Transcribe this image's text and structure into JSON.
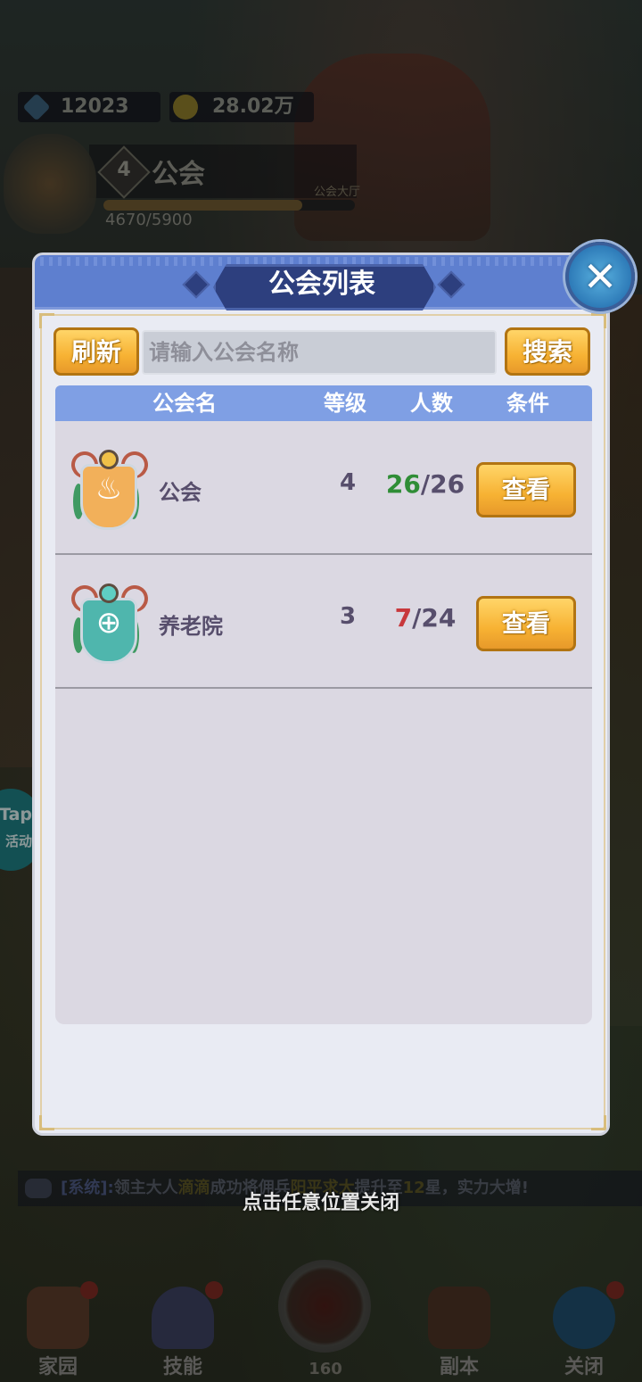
{
  "currency": {
    "gems": "12023",
    "gold": "28.02万"
  },
  "guild_header": {
    "level": "4",
    "name": "公会",
    "hall_label": "公会大厅",
    "exp_text": "4670/5900",
    "exp_fraction": 0.79
  },
  "side_button": {
    "line1": "Tap",
    "line2": "活动"
  },
  "system_message": {
    "tag": "[系统]:",
    "text_a": "领主大人",
    "highlight_a": "滴滴",
    "text_b": "成功将佣兵",
    "highlight_b": "阳平求大",
    "text_c": "提升至",
    "highlight_c": "12",
    "text_d": "星，实力大增!"
  },
  "dialog": {
    "title": "公会列表",
    "refresh_label": "刷新",
    "search_placeholder": "请输入公会名称",
    "search_value": "",
    "search_label": "搜索",
    "columns": {
      "name": "公会名",
      "level": "等级",
      "members": "人数",
      "condition": "条件"
    },
    "rows": [
      {
        "name": "公会",
        "level": "4",
        "members_current": "26",
        "members_max": "/26",
        "view_label": "查看",
        "emblem": "candle-emblem-icon",
        "emblem_color": "#f2b05a"
      },
      {
        "name": "养老院",
        "level": "3",
        "members_current": "7",
        "members_max": "/24",
        "view_label": "查看",
        "emblem": "target-emblem-icon",
        "emblem_color": "#4fb6ad"
      }
    ]
  },
  "close_hint": "点击任意位置关闭",
  "bottom_nav": {
    "home": "家园",
    "skills": "技能",
    "center_count": "160",
    "dungeon": "副本",
    "close": "关闭"
  }
}
